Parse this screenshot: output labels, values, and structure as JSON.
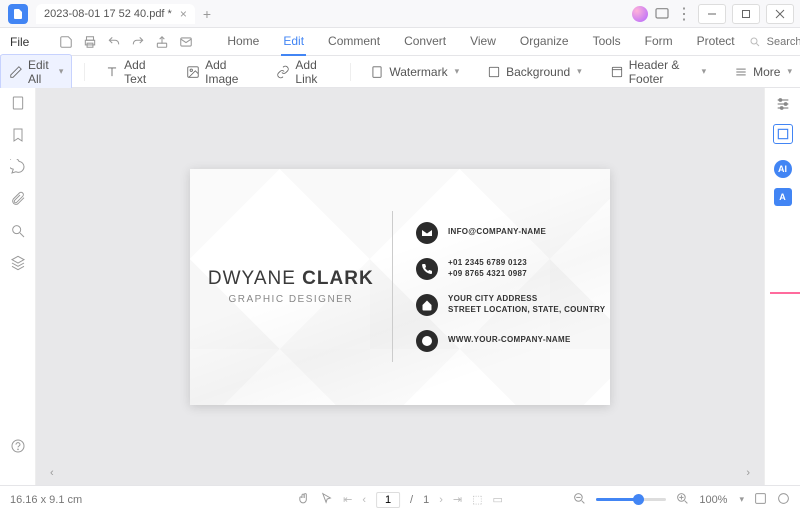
{
  "titlebar": {
    "tab_title": "2023-08-01 17 52 40.pdf *"
  },
  "menubar": {
    "file": "File",
    "items": [
      "Home",
      "Edit",
      "Comment",
      "Convert",
      "View",
      "Organize",
      "Tools",
      "Form",
      "Protect"
    ],
    "active_index": 1,
    "search_placeholder": "Search Tools"
  },
  "toolbar": {
    "edit_all": "Edit All",
    "add_text": "Add Text",
    "add_image": "Add Image",
    "add_link": "Add Link",
    "watermark": "Watermark",
    "background": "Background",
    "header_footer": "Header & Footer",
    "more": "More"
  },
  "card": {
    "name_first": "DWYANE ",
    "name_last": "CLARK",
    "title": "GRAPHIC DESIGNER",
    "email": "INFO@COMPANY-NAME",
    "phone1": "+01 2345 6789 0123",
    "phone2": "+09 8765 4321 0987",
    "addr1": "YOUR CITY ADDRESS",
    "addr2": "STREET LOCATION, STATE, COUNTRY",
    "web": "WWW.YOUR-COMPANY-NAME"
  },
  "statusbar": {
    "dimensions": "16.16 x 9.1 cm",
    "page_current": "1",
    "page_sep": "/",
    "page_total": "1",
    "zoom": "100%"
  },
  "right_badges": {
    "ai": "AI",
    "tr": "A"
  }
}
